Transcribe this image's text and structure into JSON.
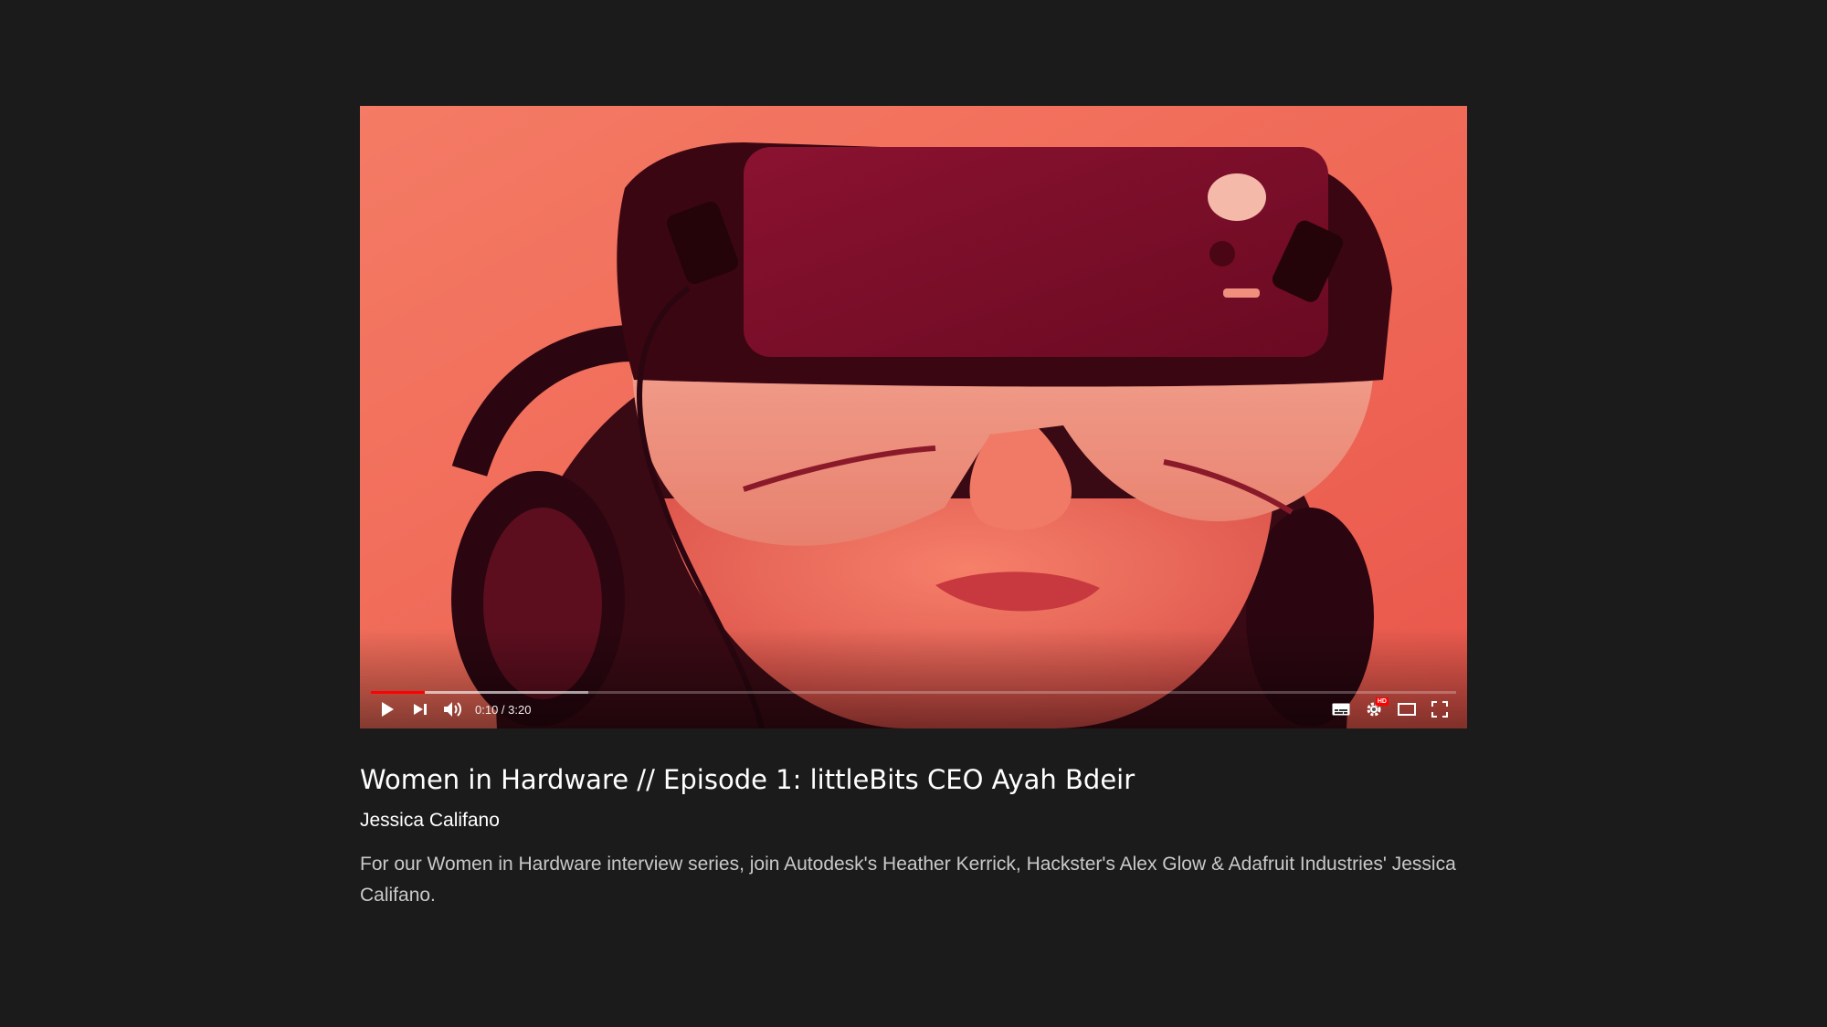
{
  "video": {
    "current_time": "0:10",
    "duration": "3:20",
    "time_separator": " / ",
    "played_fraction": 0.05,
    "loaded_fraction": 0.2,
    "thumbnail_description": "vr-headset-person-red-tint",
    "accent_color": "#ff0000",
    "thumbnail_tint": "#f27560",
    "hd_badge": "HD"
  },
  "controls": {
    "left_icons": [
      "play-icon",
      "next-icon",
      "volume-icon"
    ],
    "right_icons": [
      "subtitles-icon",
      "settings-icon",
      "theater-mode-icon",
      "fullscreen-icon"
    ]
  },
  "info": {
    "title": "Women in Hardware // Episode 1: littleBits CEO Ayah Bdeir",
    "author": "Jessica Califano",
    "description": "For our Women in Hardware interview series, join Autodesk's Heather Kerrick, Hackster's Alex Glow & Adafruit Industries' Jessica Califano."
  },
  "colors": {
    "background": "#1b1b1b",
    "title": "#ffffff",
    "description": "#c9c9c9"
  }
}
